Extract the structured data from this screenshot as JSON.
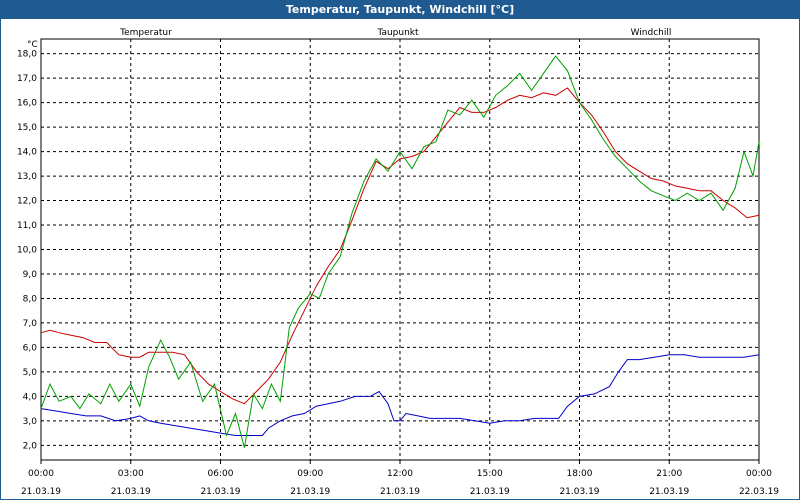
{
  "window": {
    "title": "Temperatur, Taupunkt, Windchill [°C]"
  },
  "chart_data": {
    "type": "line",
    "title": "Temperatur, Taupunkt, Windchill [°C]",
    "ylabel": "°C",
    "xlabel": "",
    "grid": true,
    "ylim": [
      1.4,
      18.6
    ],
    "xlim": [
      0,
      24
    ],
    "y_ticks": [
      "2,0",
      "3,0",
      "4,0",
      "5,0",
      "6,0",
      "7,0",
      "8,0",
      "9,0",
      "10,0",
      "11,0",
      "12,0",
      "13,0",
      "14,0",
      "15,0",
      "16,0",
      "17,0",
      "18,0"
    ],
    "x_ticks": [
      {
        "time": "00:00",
        "date": "21.03.19"
      },
      {
        "time": "03:00",
        "date": "21.03.19"
      },
      {
        "time": "06:00",
        "date": "21.03.19"
      },
      {
        "time": "09:00",
        "date": "21.03.19"
      },
      {
        "time": "12:00",
        "date": "21.03.19"
      },
      {
        "time": "15:00",
        "date": "21.03.19"
      },
      {
        "time": "18:00",
        "date": "21.03.19"
      },
      {
        "time": "21:00",
        "date": "21.03.19"
      },
      {
        "time": "00:00",
        "date": "22.03.19"
      }
    ],
    "legend_placement": "top",
    "series": [
      {
        "name": "Temperatur",
        "color": "#cc0000",
        "points": [
          [
            0,
            6.6
          ],
          [
            0.3,
            6.7
          ],
          [
            0.6,
            6.6
          ],
          [
            1,
            6.5
          ],
          [
            1.4,
            6.4
          ],
          [
            1.8,
            6.2
          ],
          [
            2.2,
            6.2
          ],
          [
            2.6,
            5.7
          ],
          [
            3,
            5.6
          ],
          [
            3.3,
            5.6
          ],
          [
            3.6,
            5.8
          ],
          [
            4,
            5.8
          ],
          [
            4.4,
            5.8
          ],
          [
            4.8,
            5.7
          ],
          [
            5.2,
            5.0
          ],
          [
            5.6,
            4.5
          ],
          [
            6,
            4.2
          ],
          [
            6.4,
            3.9
          ],
          [
            6.8,
            3.7
          ],
          [
            7.2,
            4.2
          ],
          [
            7.6,
            4.7
          ],
          [
            8,
            5.4
          ],
          [
            8.4,
            6.5
          ],
          [
            8.8,
            7.5
          ],
          [
            9.2,
            8.5
          ],
          [
            9.6,
            9.3
          ],
          [
            10,
            10.0
          ],
          [
            10.4,
            11.2
          ],
          [
            10.8,
            12.5
          ],
          [
            11.2,
            13.6
          ],
          [
            11.6,
            13.3
          ],
          [
            12,
            13.7
          ],
          [
            12.4,
            13.8
          ],
          [
            12.8,
            14.0
          ],
          [
            13.2,
            14.6
          ],
          [
            13.6,
            15.2
          ],
          [
            14,
            15.8
          ],
          [
            14.4,
            15.6
          ],
          [
            14.8,
            15.6
          ],
          [
            15.2,
            15.8
          ],
          [
            15.6,
            16.1
          ],
          [
            16,
            16.3
          ],
          [
            16.4,
            16.2
          ],
          [
            16.8,
            16.4
          ],
          [
            17.2,
            16.3
          ],
          [
            17.6,
            16.6
          ],
          [
            18,
            16.0
          ],
          [
            18.4,
            15.5
          ],
          [
            18.8,
            14.8
          ],
          [
            19.2,
            14.0
          ],
          [
            19.6,
            13.5
          ],
          [
            20,
            13.2
          ],
          [
            20.4,
            12.9
          ],
          [
            20.8,
            12.8
          ],
          [
            21.2,
            12.6
          ],
          [
            21.6,
            12.5
          ],
          [
            22,
            12.4
          ],
          [
            22.4,
            12.4
          ],
          [
            22.8,
            12.0
          ],
          [
            23.2,
            11.7
          ],
          [
            23.6,
            11.3
          ],
          [
            24,
            11.4
          ]
        ]
      },
      {
        "name": "Taupunkt",
        "color": "#0000cc",
        "points": [
          [
            0,
            3.5
          ],
          [
            0.5,
            3.4
          ],
          [
            1,
            3.3
          ],
          [
            1.5,
            3.2
          ],
          [
            2,
            3.2
          ],
          [
            2.5,
            3.0
          ],
          [
            3,
            3.1
          ],
          [
            3.3,
            3.2
          ],
          [
            3.6,
            3.0
          ],
          [
            4,
            2.9
          ],
          [
            4.5,
            2.8
          ],
          [
            5,
            2.7
          ],
          [
            5.5,
            2.6
          ],
          [
            6,
            2.5
          ],
          [
            6.5,
            2.4
          ],
          [
            7,
            2.4
          ],
          [
            7.4,
            2.4
          ],
          [
            7.6,
            2.7
          ],
          [
            8,
            3.0
          ],
          [
            8.4,
            3.2
          ],
          [
            8.8,
            3.3
          ],
          [
            9.2,
            3.6
          ],
          [
            9.6,
            3.7
          ],
          [
            10,
            3.8
          ],
          [
            10.5,
            4.0
          ],
          [
            11,
            4.0
          ],
          [
            11.3,
            4.2
          ],
          [
            11.6,
            3.7
          ],
          [
            11.8,
            3.0
          ],
          [
            12,
            3.0
          ],
          [
            12.2,
            3.3
          ],
          [
            12.6,
            3.2
          ],
          [
            13,
            3.1
          ],
          [
            13.5,
            3.1
          ],
          [
            14,
            3.1
          ],
          [
            14.5,
            3.0
          ],
          [
            15,
            2.9
          ],
          [
            15.5,
            3.0
          ],
          [
            16,
            3.0
          ],
          [
            16.5,
            3.1
          ],
          [
            17,
            3.1
          ],
          [
            17.3,
            3.1
          ],
          [
            17.6,
            3.6
          ],
          [
            18,
            4.0
          ],
          [
            18.5,
            4.1
          ],
          [
            19,
            4.4
          ],
          [
            19.3,
            5.0
          ],
          [
            19.6,
            5.5
          ],
          [
            20,
            5.5
          ],
          [
            20.5,
            5.6
          ],
          [
            21,
            5.7
          ],
          [
            21.5,
            5.7
          ],
          [
            22,
            5.6
          ],
          [
            22.5,
            5.6
          ],
          [
            23,
            5.6
          ],
          [
            23.5,
            5.6
          ],
          [
            24,
            5.7
          ]
        ]
      },
      {
        "name": "Windchill",
        "color": "#00a000",
        "points": [
          [
            0,
            3.5
          ],
          [
            0.3,
            4.5
          ],
          [
            0.6,
            3.8
          ],
          [
            1,
            4.0
          ],
          [
            1.3,
            3.5
          ],
          [
            1.6,
            4.1
          ],
          [
            2,
            3.7
          ],
          [
            2.3,
            4.5
          ],
          [
            2.6,
            3.8
          ],
          [
            3,
            4.5
          ],
          [
            3.3,
            3.6
          ],
          [
            3.6,
            5.2
          ],
          [
            4,
            6.3
          ],
          [
            4.3,
            5.6
          ],
          [
            4.6,
            4.7
          ],
          [
            5,
            5.4
          ],
          [
            5.4,
            3.8
          ],
          [
            5.8,
            4.5
          ],
          [
            6.2,
            2.4
          ],
          [
            6.5,
            3.3
          ],
          [
            6.8,
            1.9
          ],
          [
            7.1,
            4.1
          ],
          [
            7.4,
            3.5
          ],
          [
            7.7,
            4.5
          ],
          [
            8,
            3.8
          ],
          [
            8.3,
            6.8
          ],
          [
            8.6,
            7.6
          ],
          [
            9,
            8.2
          ],
          [
            9.3,
            8.0
          ],
          [
            9.6,
            9.0
          ],
          [
            10,
            9.7
          ],
          [
            10.4,
            11.5
          ],
          [
            10.8,
            12.8
          ],
          [
            11.2,
            13.7
          ],
          [
            11.6,
            13.2
          ],
          [
            12,
            14.0
          ],
          [
            12.4,
            13.3
          ],
          [
            12.8,
            14.2
          ],
          [
            13.2,
            14.4
          ],
          [
            13.6,
            15.7
          ],
          [
            14,
            15.5
          ],
          [
            14.4,
            16.1
          ],
          [
            14.8,
            15.4
          ],
          [
            15.2,
            16.3
          ],
          [
            15.6,
            16.7
          ],
          [
            16,
            17.2
          ],
          [
            16.4,
            16.5
          ],
          [
            16.8,
            17.2
          ],
          [
            17.2,
            17.9
          ],
          [
            17.6,
            17.3
          ],
          [
            18,
            16.0
          ],
          [
            18.4,
            15.3
          ],
          [
            18.8,
            14.5
          ],
          [
            19.2,
            13.8
          ],
          [
            19.6,
            13.3
          ],
          [
            20,
            12.8
          ],
          [
            20.4,
            12.4
          ],
          [
            20.8,
            12.2
          ],
          [
            21.2,
            12.0
          ],
          [
            21.6,
            12.3
          ],
          [
            22,
            12.0
          ],
          [
            22.4,
            12.3
          ],
          [
            22.8,
            11.6
          ],
          [
            23.2,
            12.5
          ],
          [
            23.5,
            14.0
          ],
          [
            23.8,
            13.0
          ],
          [
            24,
            14.4
          ]
        ]
      }
    ]
  }
}
